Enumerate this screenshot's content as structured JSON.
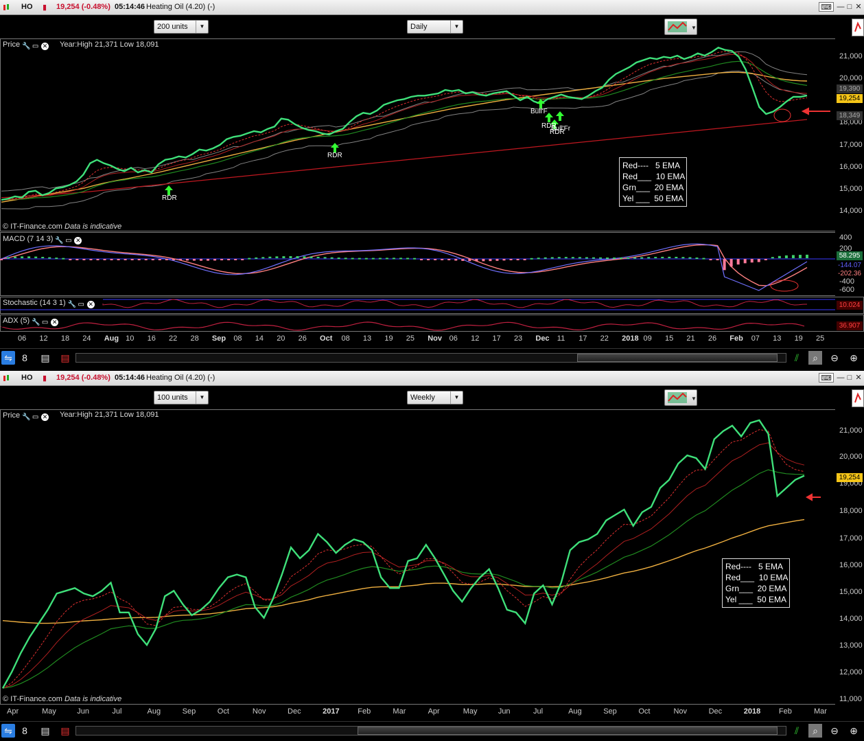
{
  "top": {
    "symbol": "HO",
    "price_change": "19,254 (-0.48%)",
    "time": "05:14:46",
    "instrument": "Heating Oil (4.20) (-)",
    "units": "200 units",
    "interval": "Daily",
    "price_label": "Price",
    "year_range": "Year:High 21,371 Low 18,091",
    "copyright": "© IT-Finance.com",
    "indicative": "Data is indicative",
    "y_ticks": [
      "21,000",
      "20,000",
      "19,000",
      "18,000",
      "17,000",
      "16,000",
      "15,000",
      "14,000"
    ],
    "price_boxes": {
      "ema_a": "19,390",
      "last": "19,254",
      "ema_b": "18,349"
    },
    "macd_label": "MACD (7 14 3)",
    "macd_ticks": [
      "400",
      "200",
      "0",
      "-400",
      "-600"
    ],
    "macd_values": {
      "a": "58.295",
      "b": "-144.07",
      "c": "-202.36"
    },
    "stoch_label": "Stochastic (14 3 1)",
    "stoch_value": "10.024",
    "adx_label": "ADX (5)",
    "adx_value": "36.907",
    "signals": [
      "RDR",
      "RDR",
      "Bull'F",
      "RDR",
      "RDR",
      "Bull'Fr"
    ],
    "legend": [
      "Red----   5 EMA",
      "Red___  10 EMA",
      "Grn___  20 EMA",
      "Yel ___  50 EMA"
    ],
    "x_labels": [
      "06",
      "12",
      "18",
      "24",
      "Aug",
      "10",
      "16",
      "22",
      "28",
      "Sep",
      "08",
      "14",
      "20",
      "26",
      "Oct",
      "08",
      "13",
      "19",
      "25",
      "Nov",
      "06",
      "12",
      "17",
      "23",
      "Dec",
      "11",
      "17",
      "22",
      "2018",
      "09",
      "15",
      "21",
      "26",
      "Feb",
      "07",
      "13",
      "19",
      "25"
    ]
  },
  "bottom": {
    "symbol": "HO",
    "price_change": "19,254 (-0.48%)",
    "time": "05:14:46",
    "instrument": "Heating Oil (4.20) (-)",
    "units": "100 units",
    "interval": "Weekly",
    "price_label": "Price",
    "year_range": "Year:High 21,371 Low 18,091",
    "copyright": "© IT-Finance.com",
    "indicative": "Data is indicative",
    "y_ticks": [
      "21,000",
      "20,000",
      "19,000",
      "18,000",
      "17,000",
      "16,000",
      "15,000",
      "14,000",
      "13,000",
      "12,000",
      "11,000"
    ],
    "last_price": "19,254",
    "legend": [
      "Red----   5 EMA",
      "Red___  10 EMA",
      "Grn___  20 EMA",
      "Yel ___  50 EMA"
    ],
    "x_labels": [
      "Apr",
      "May",
      "Jun",
      "Jul",
      "Aug",
      "Sep",
      "Oct",
      "Nov",
      "Dec",
      "2017",
      "Feb",
      "Mar",
      "Apr",
      "May",
      "Jun",
      "Jul",
      "Aug",
      "Sep",
      "Oct",
      "Nov",
      "Dec",
      "2018",
      "Feb",
      "Mar"
    ]
  },
  "colors": {
    "price": "#3fe07a",
    "ema5": "#e03030",
    "ema10": "#b02020",
    "ema20": "#208a20",
    "ema50": "#f0b040",
    "ema200": "#c01820",
    "last_bg": "#f5c518",
    "macd": "#7070ff",
    "macd_hist_pos": "#3fcf6a",
    "macd_hist_neg": "#ff7a9a"
  },
  "chart_data": [
    {
      "type": "line",
      "title": "",
      "ylim": [
        13500,
        21600
      ],
      "series": [
        {
          "name": "Price",
          "values": [
            14700,
            14750,
            14850,
            14800,
            15050,
            15100,
            14900,
            15000,
            15200,
            15250,
            15350,
            15500,
            15800,
            16300,
            16450,
            16300,
            16200,
            16050,
            15950,
            16100,
            15900,
            16000,
            15900,
            16250,
            16450,
            16500,
            16600,
            16550,
            16700,
            16900,
            16850,
            16950,
            17100,
            17350,
            17450,
            17500,
            17600,
            17700,
            17650,
            17800,
            17900,
            18250,
            18200,
            18000,
            17850,
            17750,
            17700,
            17600,
            17550,
            17700,
            17800,
            18100,
            18350,
            18500,
            18450,
            18600,
            18850,
            18950,
            19050,
            19100,
            19200,
            19250,
            19250,
            19300,
            19350,
            19500,
            19450,
            19500,
            19350,
            19400,
            19300,
            19250,
            19350,
            19400,
            19450,
            19250,
            19050,
            19200,
            19000,
            18900,
            19100,
            19200,
            19300,
            19200,
            19150,
            19100,
            19250,
            19450,
            19600,
            19950,
            20200,
            20350,
            20500,
            20700,
            20800,
            20900,
            20850,
            20950,
            20900,
            21000,
            20850,
            20950,
            21100,
            21000,
            21150,
            21350,
            21250,
            21200,
            20950,
            20400,
            19600,
            18750,
            18450,
            18550,
            18750,
            19000,
            19200,
            19200,
            19254
          ]
        },
        {
          "name": "EMA 50",
          "values": [
            14600,
            14650,
            14700,
            14750,
            14800,
            14850,
            14900,
            14950,
            15000,
            15050,
            15100,
            15150,
            15200,
            15280,
            15360,
            15430,
            15490,
            15550,
            15600,
            15660,
            15720,
            15780,
            15840,
            15900,
            15970,
            16040,
            16110,
            16180,
            16250,
            16320,
            16390,
            16460,
            16530,
            16600,
            16670,
            16740,
            16810,
            16880,
            16950,
            17020,
            17090,
            17160,
            17230,
            17300,
            17360,
            17420,
            17480,
            17540,
            17600,
            17660,
            17720,
            17780,
            17840,
            17900,
            17960,
            18020,
            18080,
            18140,
            18200,
            18260,
            18320,
            18380,
            18440,
            18500,
            18560,
            18620,
            18680,
            18730,
            18780,
            18830,
            18880,
            18930,
            18980,
            19030,
            19080,
            19120,
            19160,
            19200,
            19240,
            19280,
            19320,
            19360,
            19400,
            19440,
            19480,
            19520,
            19560,
            19600,
            19640,
            19680,
            19720,
            19760,
            19800,
            19840,
            19880,
            19920,
            19960,
            20000,
            20030,
            20060,
            20090,
            20120,
            20150,
            20180,
            20210,
            20240,
            20260,
            20270,
            20270,
            20250,
            20210,
            20160,
            20100,
            20040,
            19990,
            19950,
            19920,
            19900,
            19890
          ]
        },
        {
          "name": "EMA 200",
          "values": [
            14800,
            14810,
            14830,
            14850,
            14870,
            14890,
            14910,
            14930,
            14950,
            14970,
            14990,
            15010,
            15030,
            15060,
            15090,
            15120,
            15150,
            15180,
            15210,
            15240,
            15270,
            15300,
            15330,
            15360,
            15390,
            15420,
            15450,
            15480,
            15510,
            15540,
            15570,
            15600,
            15630,
            15660,
            15690,
            15720,
            15750,
            15780,
            15810,
            15840,
            15870,
            15900,
            15930,
            15960,
            15990,
            16020,
            16050,
            16080,
            16110,
            16140,
            16170,
            16200,
            16230,
            16260,
            16290,
            16320,
            16350,
            16380,
            16410,
            16440,
            16470,
            16500,
            16530,
            16560,
            16590,
            16620,
            16650,
            16680,
            16710,
            16740,
            16770,
            16800,
            16830,
            16860,
            16890,
            16920,
            16950,
            16980,
            17010,
            17040,
            17070,
            17100,
            17130,
            17160,
            17190,
            17220,
            17250,
            17280,
            17310,
            17340,
            17370,
            17400,
            17430,
            17460,
            17490,
            17520,
            17550,
            17580,
            17610,
            17640,
            17670,
            17700,
            17730,
            17760,
            17790,
            17820,
            17850,
            17880,
            17910,
            17940,
            17970,
            18000,
            18030,
            18060,
            18090,
            18120,
            18150,
            18180,
            18210
          ]
        }
      ]
    },
    {
      "type": "line",
      "title": "",
      "ylim": [
        11000,
        21500
      ],
      "series": [
        {
          "name": "Price",
          "values": [
            11400,
            12000,
            12700,
            13300,
            13800,
            14300,
            14900,
            15000,
            15100,
            14900,
            14800,
            15000,
            15300,
            14200,
            14200,
            13400,
            13000,
            13600,
            14800,
            15000,
            14500,
            14100,
            14300,
            14600,
            15100,
            15500,
            15600,
            15500,
            14400,
            14000,
            14700,
            15600,
            16600,
            16200,
            16500,
            17100,
            16800,
            16400,
            16700,
            16900,
            16800,
            16500,
            15500,
            15100,
            15100,
            16100,
            16200,
            16700,
            16200,
            15600,
            15000,
            14600,
            15100,
            15500,
            15800,
            15100,
            14300,
            14200,
            13800,
            14900,
            15200,
            14500,
            15300,
            16500,
            16800,
            16900,
            17100,
            17600,
            17800,
            18000,
            17400,
            17900,
            18100,
            18800,
            19100,
            19700,
            20000,
            19900,
            19500,
            20600,
            20900,
            21100,
            20700,
            21200,
            21300,
            20800,
            18500,
            18800,
            19100,
            19254
          ]
        },
        {
          "name": "EMA 50",
          "values": [
            13900,
            13870,
            13840,
            13820,
            13800,
            13800,
            13810,
            13830,
            13860,
            13890,
            13910,
            13930,
            13960,
            13980,
            14000,
            14010,
            14010,
            14020,
            14050,
            14080,
            14100,
            14110,
            14130,
            14150,
            14190,
            14240,
            14290,
            14340,
            14360,
            14380,
            14410,
            14460,
            14540,
            14600,
            14670,
            14760,
            14830,
            14890,
            14960,
            15020,
            15080,
            15130,
            15150,
            15150,
            15150,
            15180,
            15210,
            15260,
            15280,
            15280,
            15260,
            15230,
            15230,
            15240,
            15260,
            15250,
            15220,
            15200,
            15160,
            15160,
            15160,
            15150,
            15160,
            15210,
            15270,
            15330,
            15400,
            15480,
            15570,
            15660,
            15720,
            15800,
            15890,
            16000,
            16110,
            16230,
            16360,
            16480,
            16580,
            16700,
            16820,
            16950,
            17060,
            17180,
            17300,
            17400,
            17460,
            17520,
            17580,
            17630
          ]
        }
      ]
    }
  ]
}
